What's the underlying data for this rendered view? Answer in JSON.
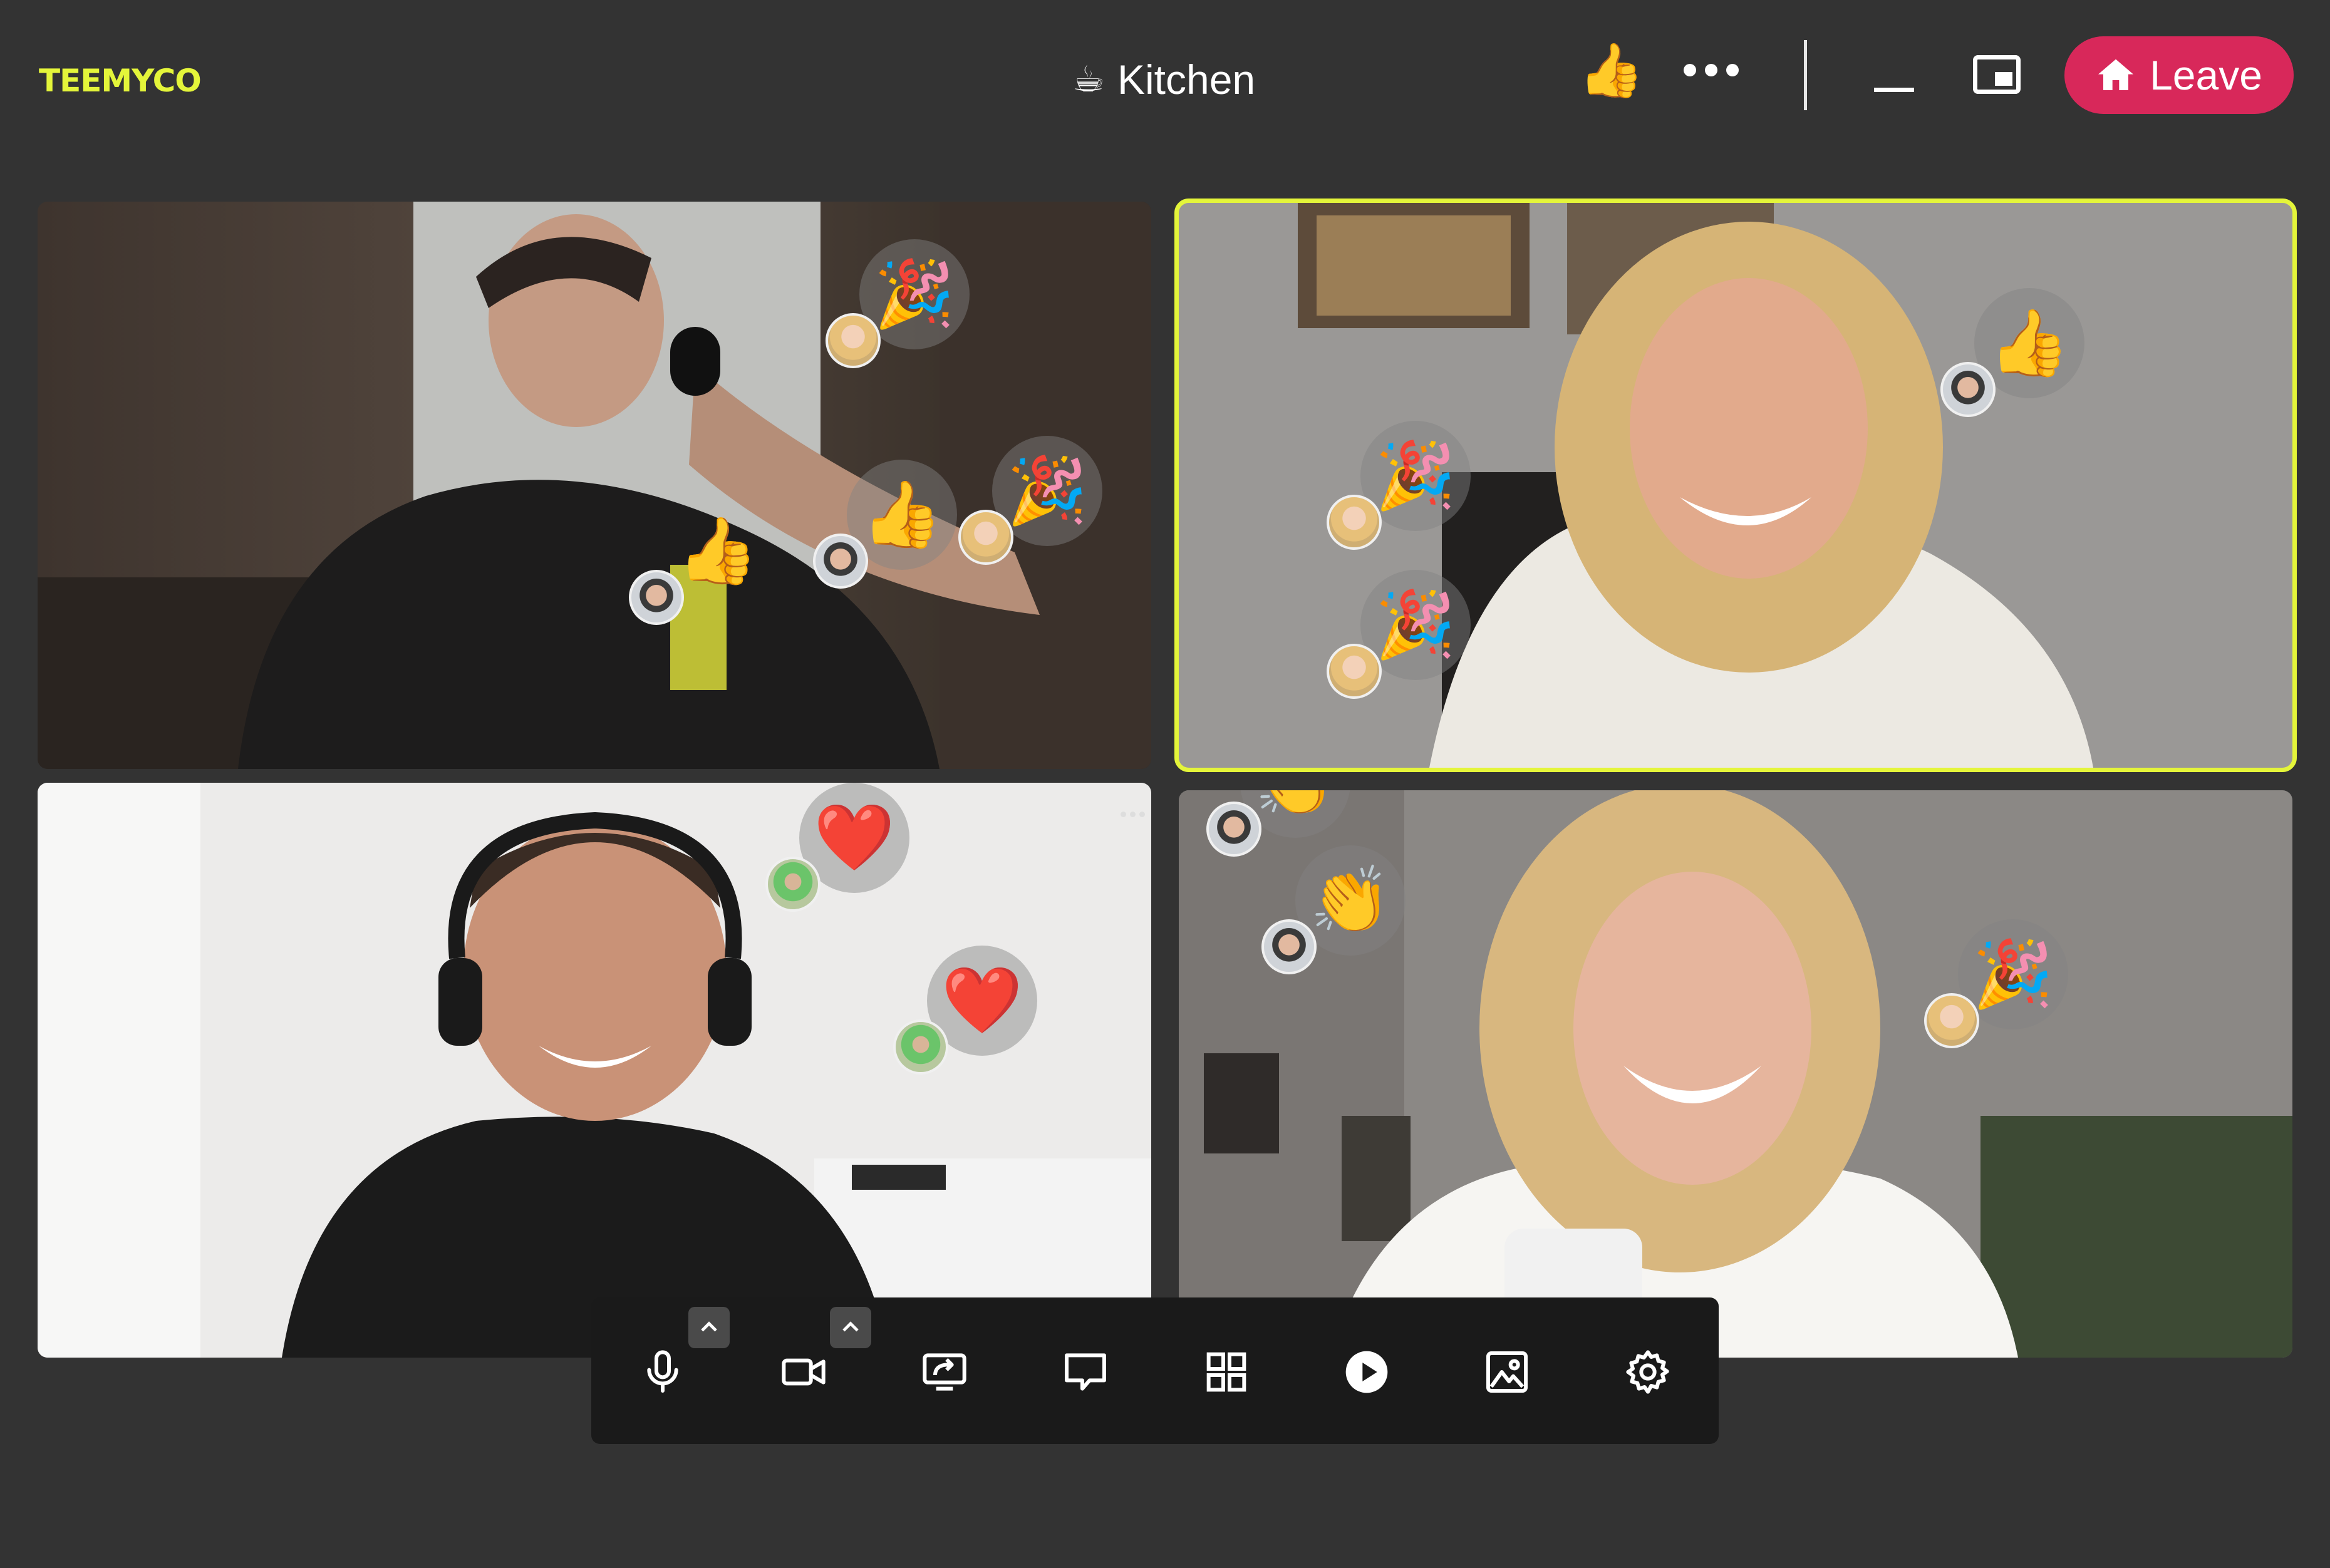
{
  "app": {
    "logo": "TEEMYCO"
  },
  "header": {
    "room_emoji": "☕",
    "room_name": "Kitchen",
    "reaction_icon": "thumbs-up-icon",
    "more_icon": "more-horizontal-icon",
    "minimize_icon": "minimize-icon",
    "pip_icon": "picture-in-picture-icon",
    "leave_label": "Leave",
    "leave_icon": "home-icon",
    "leave_color": "#d8285a",
    "accent_color": "#e4f53a"
  },
  "tiles": [
    {
      "id": "participant-1",
      "active_speaker": false,
      "reactions": [
        {
          "emoji": "🎉",
          "sender": "blonde"
        },
        {
          "emoji": "👍",
          "sender": "dark"
        },
        {
          "emoji": "🎉",
          "sender": "blonde"
        },
        {
          "emoji": "👍",
          "sender": "dark"
        }
      ]
    },
    {
      "id": "participant-2",
      "active_speaker": true,
      "reactions": [
        {
          "emoji": "👍",
          "sender": "dark"
        },
        {
          "emoji": "🎉",
          "sender": "blonde"
        },
        {
          "emoji": "🎉",
          "sender": "blonde"
        }
      ]
    },
    {
      "id": "participant-3",
      "active_speaker": false,
      "reactions": [
        {
          "emoji": "❤️",
          "sender": "green"
        },
        {
          "emoji": "❤️",
          "sender": "green"
        }
      ]
    },
    {
      "id": "participant-4",
      "active_speaker": false,
      "reactions": [
        {
          "emoji": "👏",
          "sender": "dark"
        },
        {
          "emoji": "👏",
          "sender": "dark"
        },
        {
          "emoji": "🎉",
          "sender": "blonde"
        }
      ]
    }
  ],
  "controls": [
    {
      "name": "microphone",
      "icon": "microphone-icon"
    },
    {
      "name": "camera",
      "icon": "video-camera-icon"
    },
    {
      "name": "share-screen",
      "icon": "share-screen-icon"
    },
    {
      "name": "chat",
      "icon": "chat-icon"
    },
    {
      "name": "layout",
      "icon": "grid-icon"
    },
    {
      "name": "play",
      "icon": "play-icon"
    },
    {
      "name": "background",
      "icon": "image-icon"
    },
    {
      "name": "settings",
      "icon": "gear-icon"
    }
  ]
}
